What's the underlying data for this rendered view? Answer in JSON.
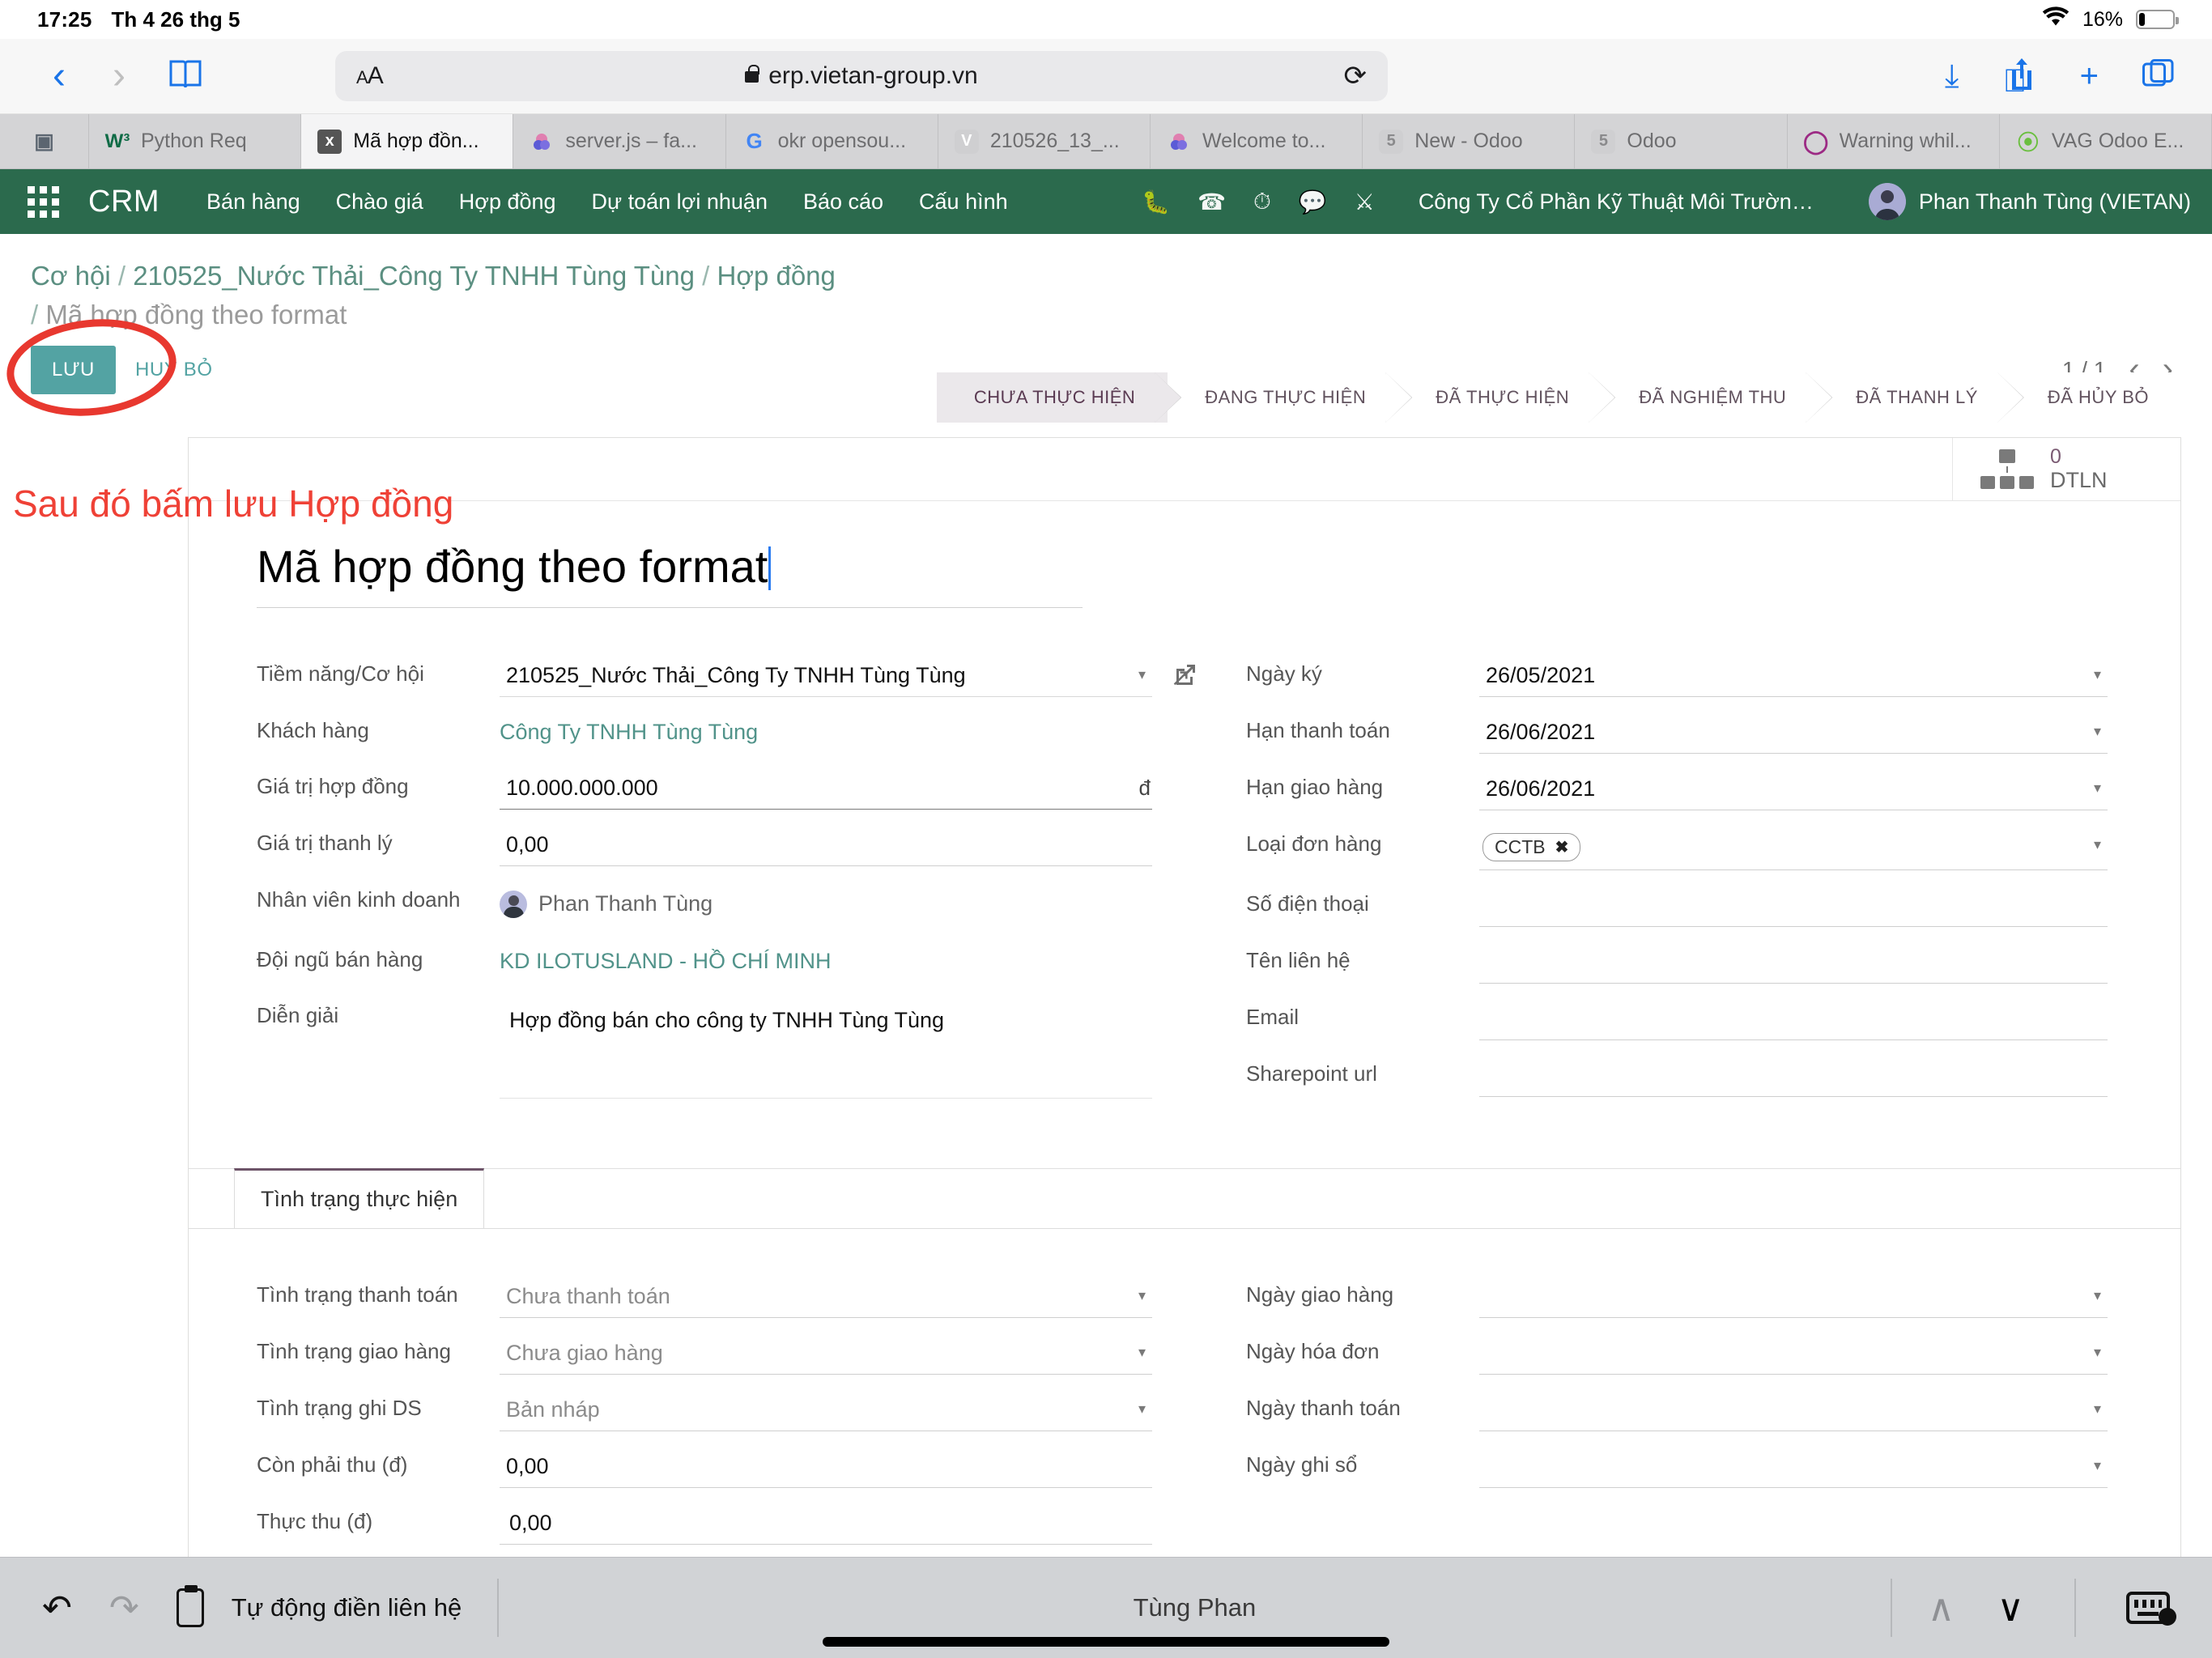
{
  "device": {
    "status_bar": {
      "time": "17:25",
      "date": "Th 4 26 thg 5",
      "battery_percent": "16%",
      "wifi_icon": "wifi-icon",
      "battery_icon": "battery-icon"
    },
    "home_indicator": "home-indicator"
  },
  "browser": {
    "back_icon": "chevron-left-icon",
    "forward_icon": "chevron-right-icon",
    "bookmarks_icon": "book-icon",
    "text_size_label": "AA",
    "url": "erp.vietan-group.vn",
    "lock_icon": "lock-icon",
    "reload_icon": "reload-icon",
    "downloads_icon": "download-icon",
    "share_icon": "share-icon",
    "new_tab_icon": "plus-icon",
    "tabs_overview_icon": "tabs-icon",
    "tabs": [
      {
        "label": "",
        "favicon": "sidebar-icon",
        "type": "narrow",
        "active": false
      },
      {
        "label": "Python Req",
        "favicon": "w3-icon",
        "active": false
      },
      {
        "label": "Mã hợp đồn...",
        "favicon": "x-icon",
        "active": true
      },
      {
        "label": "server.js – fa...",
        "favicon": "cloud-icon",
        "active": false
      },
      {
        "label": "okr opensou...",
        "favicon": "google-icon",
        "active": false
      },
      {
        "label": "210526_13_...",
        "favicon": "v-icon",
        "active": false
      },
      {
        "label": "Welcome to...",
        "favicon": "cloud-icon",
        "active": false
      },
      {
        "label": "New - Odoo",
        "favicon": "five-icon",
        "active": false
      },
      {
        "label": "Odoo",
        "favicon": "five-icon",
        "active": false
      },
      {
        "label": "Warning whil...",
        "favicon": "o-icon",
        "active": false
      },
      {
        "label": "VAG Odoo E...",
        "favicon": "leaf-icon",
        "active": false
      }
    ]
  },
  "odoo_nav": {
    "apps_icon": "apps-grid-icon",
    "brand": "CRM",
    "menu": [
      "Bán hàng",
      "Chào giá",
      "Hợp đồng",
      "Dự toán lợi nhuận",
      "Báo cáo",
      "Cấu hình"
    ],
    "systray_icons": [
      "bug-icon",
      "phone-icon",
      "clock-icon",
      "chat-icon",
      "tools-icon"
    ],
    "company": "Công Ty Cổ Phần Kỹ Thuật Môi Trường Vi...",
    "user": "Phan Thanh Tùng (VIETAN)",
    "avatar_icon": "avatar-icon",
    "bg_color": "#2b6a4d"
  },
  "control_panel": {
    "breadcrumb": [
      "Cơ hội",
      "210525_Nước Thải_Công Ty TNHH Tùng Tùng",
      "Hợp đồng"
    ],
    "breadcrumb_current": "Mã hợp đồng theo format",
    "separator": "/",
    "save_label": "LƯU",
    "discard_label": "HUỶ BỎ",
    "pager": "1 / 1",
    "pager_prev_icon": "chevron-left-icon",
    "pager_next_icon": "chevron-right-icon"
  },
  "annotation": {
    "text": "Sau đó bấm lưu Hợp đồng",
    "color": "#ef4136",
    "ellipse_name": "annotation-ellipse"
  },
  "statusbar": {
    "stages": [
      "CHƯA THỰC HIỆN",
      "ĐANG THỰC HIỆN",
      "ĐÃ THỰC HIỆN",
      "ĐÃ NGHIỆM THU",
      "ĐÃ THANH LÝ",
      "ĐÃ HỦY BỎ"
    ],
    "active_index": 0
  },
  "stat_button": {
    "icon": "hierarchy-icon",
    "value": "0",
    "label": "DTLN"
  },
  "form": {
    "title": "Mã hợp đồng theo format",
    "left_fields": [
      {
        "label": "Tiềm năng/Cơ hội",
        "value": "210525_Nước Thải_Công Ty TNHH Tùng Tùng",
        "kind": "select_ext"
      },
      {
        "label": "Khách hàng",
        "value": "Công Ty TNHH Tùng Tùng",
        "kind": "link"
      },
      {
        "label": "Giá trị hợp đồng",
        "value": "10.000.000.000",
        "kind": "money",
        "suffix": "đ"
      },
      {
        "label": "Giá trị thanh lý",
        "value": "0,00",
        "kind": "text"
      },
      {
        "label": "Nhân viên kinh doanh",
        "value": "Phan Thanh Tùng",
        "kind": "avatar"
      },
      {
        "label": "Đội ngũ bán hàng",
        "value": "KD ILOTUSLAND - HỒ CHÍ MINH",
        "kind": "link"
      },
      {
        "label": "Diễn giải",
        "value": "Hợp đồng bán cho công ty TNHH Tùng Tùng",
        "kind": "textarea"
      }
    ],
    "right_fields": [
      {
        "label": "Ngày ký",
        "value": "26/05/2021",
        "kind": "date"
      },
      {
        "label": "Hạn thanh toán",
        "value": "26/06/2021",
        "kind": "date"
      },
      {
        "label": "Hạn giao hàng",
        "value": "26/06/2021",
        "kind": "date"
      },
      {
        "label": "Loại đơn hàng",
        "value": "CCTB",
        "kind": "tag"
      },
      {
        "label": "Số điện thoại",
        "value": "",
        "kind": "text"
      },
      {
        "label": "Tên liên hệ",
        "value": "",
        "kind": "text"
      },
      {
        "label": "Email",
        "value": "",
        "kind": "text"
      },
      {
        "label": "Sharepoint url",
        "value": "",
        "kind": "text"
      }
    ],
    "notebook": {
      "tabs": [
        "Tình trạng thực hiện"
      ],
      "active_tab": 0,
      "left_fields": [
        {
          "label": "Tình trạng thanh toán",
          "value": "Chưa thanh toán",
          "kind": "select_gray"
        },
        {
          "label": "Tình trạng giao hàng",
          "value": "Chưa giao hàng",
          "kind": "select_gray"
        },
        {
          "label": "Tình trạng ghi DS",
          "value": "Bản nháp",
          "kind": "select_gray"
        },
        {
          "label": "Còn phải thu (đ)",
          "value": "0,00",
          "kind": "text"
        },
        {
          "label": "Thực thu (đ)",
          "value": "0,00",
          "kind": "text"
        }
      ],
      "right_fields": [
        {
          "label": "Ngày giao hàng",
          "value": "",
          "kind": "date"
        },
        {
          "label": "Ngày hóa đơn",
          "value": "",
          "kind": "date"
        },
        {
          "label": "Ngày thanh toán",
          "value": "",
          "kind": "date"
        },
        {
          "label": "Ngày ghi sổ",
          "value": "",
          "kind": "date"
        }
      ]
    }
  },
  "bottom_toolbar": {
    "undo_icon": "undo-icon",
    "redo_icon": "redo-icon",
    "paste_icon": "paste-icon",
    "suggestion": "Tự động điền liên hệ",
    "center_text": "Tùng Phan",
    "up_icon": "chevron-up-icon",
    "down_icon": "chevron-down-icon",
    "keyboard_icon": "keyboard-icon"
  }
}
